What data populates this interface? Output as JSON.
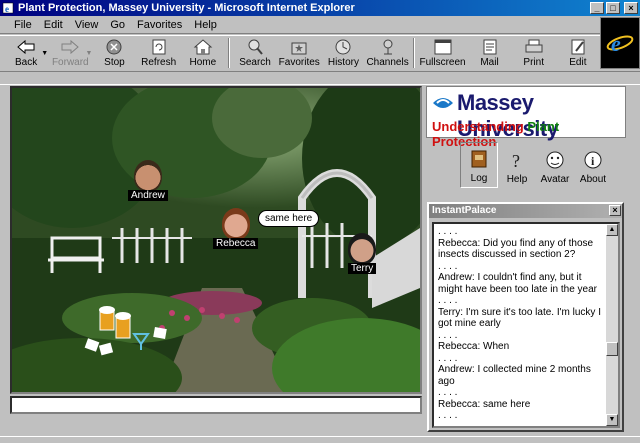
{
  "window": {
    "title": "Plant Protection, Massey University - Microsoft Internet Explorer"
  },
  "menu": [
    "File",
    "Edit",
    "View",
    "Go",
    "Favorites",
    "Help"
  ],
  "toolbar": [
    {
      "label": "Back",
      "icon": "back-arrow-icon",
      "enabled": true
    },
    {
      "label": "Forward",
      "icon": "forward-arrow-icon",
      "enabled": false
    },
    {
      "label": "Stop",
      "icon": "stop-icon",
      "enabled": true
    },
    {
      "label": "Refresh",
      "icon": "refresh-icon",
      "enabled": true
    },
    {
      "label": "Home",
      "icon": "home-icon",
      "enabled": true
    },
    {
      "label": "Search",
      "icon": "search-icon",
      "enabled": true
    },
    {
      "label": "Favorites",
      "icon": "favorites-icon",
      "enabled": true
    },
    {
      "label": "History",
      "icon": "history-icon",
      "enabled": true
    },
    {
      "label": "Channels",
      "icon": "channels-icon",
      "enabled": true
    },
    {
      "label": "Fullscreen",
      "icon": "fullscreen-icon",
      "enabled": true
    },
    {
      "label": "Mail",
      "icon": "mail-icon",
      "enabled": true
    },
    {
      "label": "Print",
      "icon": "print-icon",
      "enabled": true
    },
    {
      "label": "Edit",
      "icon": "edit-icon",
      "enabled": true
    }
  ],
  "logo": {
    "university": "Massey University",
    "tagline_red": "Understanding",
    "tagline_green": "Plant",
    "tagline_red2": "Protection"
  },
  "nav": [
    {
      "label": "Log",
      "icon": "log-book-icon"
    },
    {
      "label": "Help",
      "icon": "help-question-icon"
    },
    {
      "label": "Avatar",
      "icon": "avatar-face-icon"
    },
    {
      "label": "About",
      "icon": "about-info-icon"
    }
  ],
  "scene": {
    "avatars": [
      {
        "name": "Andrew"
      },
      {
        "name": "Rebecca"
      },
      {
        "name": "Terry"
      }
    ],
    "bubble": "same here"
  },
  "chat": {
    "title": "InstantPalace",
    "lines": [
      ". . . .",
      "Rebecca: Did you find any of those insects discussed in section 2?",
      ". . . .",
      "Andrew: I couldn't find any, but it might have been too late in the year",
      ". . . .",
      "Terry: I'm sure it's too late. I'm lucky I got mine early",
      ". . . .",
      "Rebecca:  When",
      ". . . .",
      "Andrew:   I collected mine 2 months ago",
      ". . . .",
      "Rebecca:   same here",
      ". . . ."
    ]
  },
  "colors": {
    "titlebar": "#000080",
    "logo_text": "#1a1a6e",
    "red": "#d01010",
    "green": "#108010"
  }
}
